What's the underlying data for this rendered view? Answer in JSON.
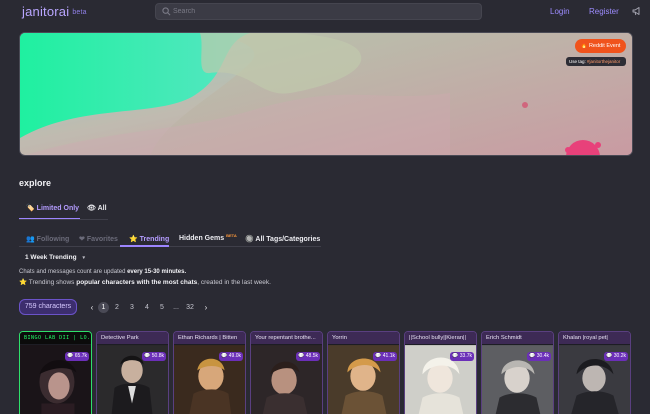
{
  "header": {
    "logo": "janitorai",
    "logo_badge": "beta",
    "search_placeholder": "Search",
    "login": "Login",
    "register": "Register",
    "icons": {
      "search": "search-icon",
      "announce": "megaphone-icon"
    }
  },
  "banner": {
    "reddit_button": "🔥 Reddit Event",
    "use_tag_prefix": "Use tag: ",
    "use_tag_value": "#janitorthejanitor",
    "colors": {
      "green": "#2ee8a6",
      "pink": "#d88aa0",
      "accent": "#f0531c"
    }
  },
  "explore": {
    "title": "explore",
    "limit_tabs": [
      {
        "label": "Limited Only",
        "icon": "🏷️"
      },
      {
        "label": "All",
        "icon": "👁"
      }
    ],
    "category_tabs": [
      {
        "label": "Following",
        "icon": "👥"
      },
      {
        "label": "Favorites",
        "icon": "❤"
      },
      {
        "label": "Trending",
        "icon": "⭐"
      },
      {
        "label": "Hidden Gems",
        "badge": "BETA"
      },
      {
        "label": "All Tags/Categories",
        "icon": "🔘"
      }
    ],
    "trend_period": "1 Week Trending",
    "info_line1_a": "Chats and messages count are updated ",
    "info_line1_b": "every 15-30 minutes.",
    "info_line2_a": "⭐ Trending shows ",
    "info_line2_b": "popular characters with the most chats",
    "info_line2_c": ", created in the last week.",
    "count_label": "759 characters",
    "pagination": [
      "1",
      "2",
      "3",
      "4",
      "5",
      "...",
      "32"
    ],
    "prev": "‹",
    "next": "›"
  },
  "cards": [
    {
      "name": "BINGO LAB DII | LO...",
      "stat": "💬 65.7k"
    },
    {
      "name": "Detective Park",
      "stat": "💬 50.8k"
    },
    {
      "name": "Ethan Richards | Bitten",
      "stat": "💬 49.0k"
    },
    {
      "name": "Your repentant brothe...",
      "stat": "💬 48.5k"
    },
    {
      "name": "Yorrin",
      "stat": "💬 41.1k"
    },
    {
      "name": "||School bully||Kieran||",
      "stat": "💬 33.7k"
    },
    {
      "name": "Erich Schmidt",
      "stat": "💬 30.4k"
    },
    {
      "name": "Khalan |royal pet|",
      "stat": "💬 30.2k"
    }
  ]
}
